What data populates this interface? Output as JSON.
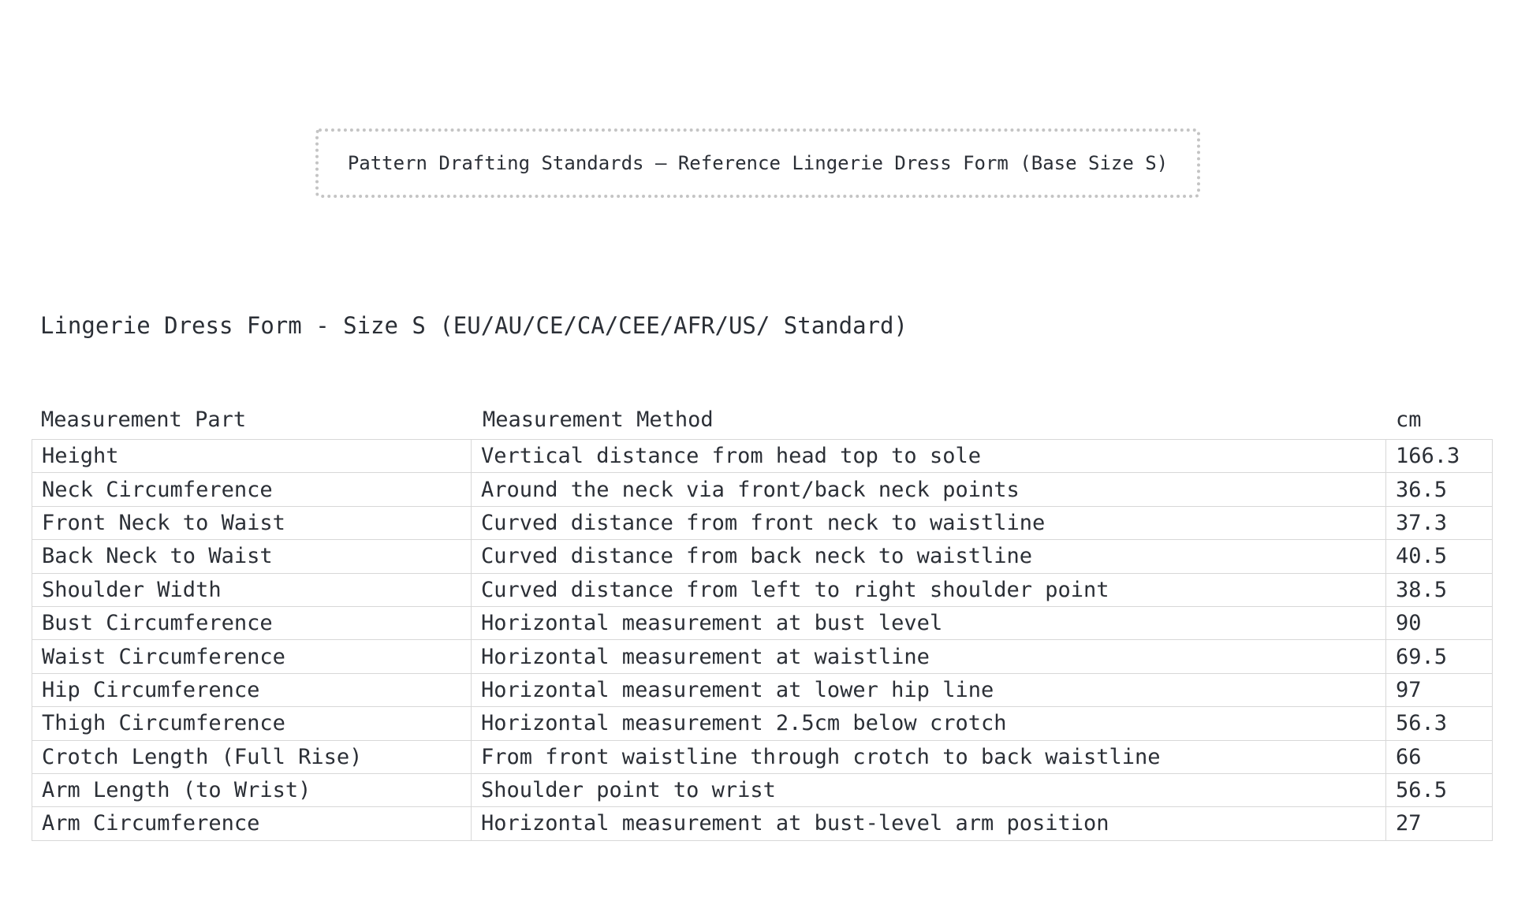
{
  "banner": {
    "text": "Pattern Drafting Standards – Reference Lingerie Dress Form (Base Size S)"
  },
  "form_title": "Lingerie Dress Form - Size S (EU/AU/CE/CA/CEE/AFR/US/ Standard)",
  "table": {
    "headers": [
      "Measurement Part",
      "Measurement Method",
      "cm"
    ],
    "rows": [
      [
        "Height",
        "Vertical distance from head top to sole",
        "166.3"
      ],
      [
        "Neck Circumference",
        "Around the neck via front/back neck points",
        "36.5"
      ],
      [
        "Front Neck to Waist",
        "Curved distance from front neck to waistline",
        "37.3"
      ],
      [
        "Back Neck to Waist",
        "Curved distance from back neck to waistline",
        "40.5"
      ],
      [
        "Shoulder Width",
        "Curved distance from left to right shoulder point",
        "38.5"
      ],
      [
        "Bust Circumference",
        "Horizontal measurement at bust level",
        "90"
      ],
      [
        "Waist Circumference",
        "Horizontal measurement at waistline",
        "69.5"
      ],
      [
        "Hip Circumference",
        "Horizontal measurement at lower hip line",
        "97"
      ],
      [
        "Thigh Circumference",
        "Horizontal measurement 2.5cm below crotch",
        "56.3"
      ],
      [
        "Crotch Length (Full Rise)",
        "From front waistline through crotch to back waistline",
        "66"
      ],
      [
        "Arm Length (to Wrist)",
        "Shoulder point to wrist",
        "56.5"
      ],
      [
        "Arm Circumference",
        "Horizontal measurement at bust-level arm position",
        "27"
      ]
    ]
  }
}
